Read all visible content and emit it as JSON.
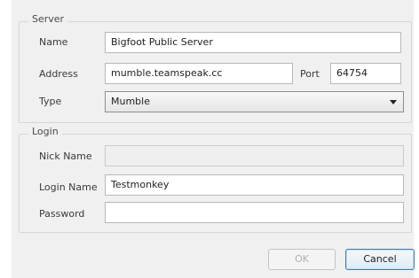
{
  "server": {
    "group_title": "Server",
    "name_label": "Name",
    "name_value": "Bigfoot Public Server",
    "address_label": "Address",
    "address_value": "mumble.teamspeak.cc",
    "port_label": "Port",
    "port_value": "64754",
    "type_label": "Type",
    "type_value": "Mumble"
  },
  "login": {
    "group_title": "Login",
    "nickname_label": "Nick Name",
    "nickname_value": "",
    "loginname_label": "Login Name",
    "loginname_value": "Testmonkey",
    "password_label": "Password",
    "password_value": ""
  },
  "buttons": {
    "ok_label": "OK",
    "cancel_label": "Cancel"
  },
  "colors": {
    "dialog_background": "#f0f0f0",
    "default_button_border": "#3c7fb1",
    "disabled_text": "#b0b0b0"
  }
}
